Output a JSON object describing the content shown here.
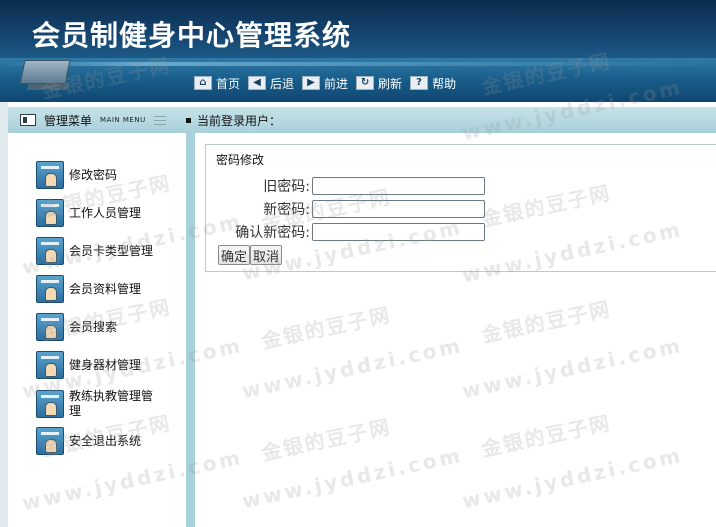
{
  "app": {
    "title": "会员制健身中心管理系统"
  },
  "toolbar": {
    "items": [
      {
        "label": "首页",
        "icon": "home-icon",
        "glyph": "⌂"
      },
      {
        "label": "后退",
        "icon": "back-arrow-icon",
        "glyph": "◀"
      },
      {
        "label": "前进",
        "icon": "forward-arrow-icon",
        "glyph": "▶"
      },
      {
        "label": "刷新",
        "icon": "refresh-icon",
        "glyph": "↻"
      },
      {
        "label": "帮助",
        "icon": "help-icon",
        "glyph": "?"
      }
    ]
  },
  "menu_header": {
    "title": "管理菜单",
    "subtitle": "MAIN MENU"
  },
  "status": {
    "current_user_label": "当前登录用户："
  },
  "sidebar": {
    "items": [
      {
        "label": "修改密码"
      },
      {
        "label": "工作人员管理"
      },
      {
        "label": "会员卡类型管理"
      },
      {
        "label": "会员资料管理"
      },
      {
        "label": "会员搜索"
      },
      {
        "label": "健身器材管理"
      },
      {
        "label": "教练执教管理管理"
      },
      {
        "label": "安全退出系统"
      }
    ]
  },
  "password_form": {
    "title": "密码修改",
    "old_password_label": "旧密码:",
    "new_password_label": "新密码:",
    "confirm_password_label": "确认新密码:",
    "old_password_value": "",
    "new_password_value": "",
    "confirm_password_value": "",
    "confirm_button": "确定",
    "cancel_button": "取消"
  },
  "watermark": {
    "text_cn": "金银的豆子网",
    "text_url": "www.jyddzi.com"
  },
  "colors": {
    "banner_dark": "#0c2d4e",
    "banner_mid": "#1d5a86",
    "bar_light": "#c7e2e9",
    "divider": "#a8d1db"
  }
}
